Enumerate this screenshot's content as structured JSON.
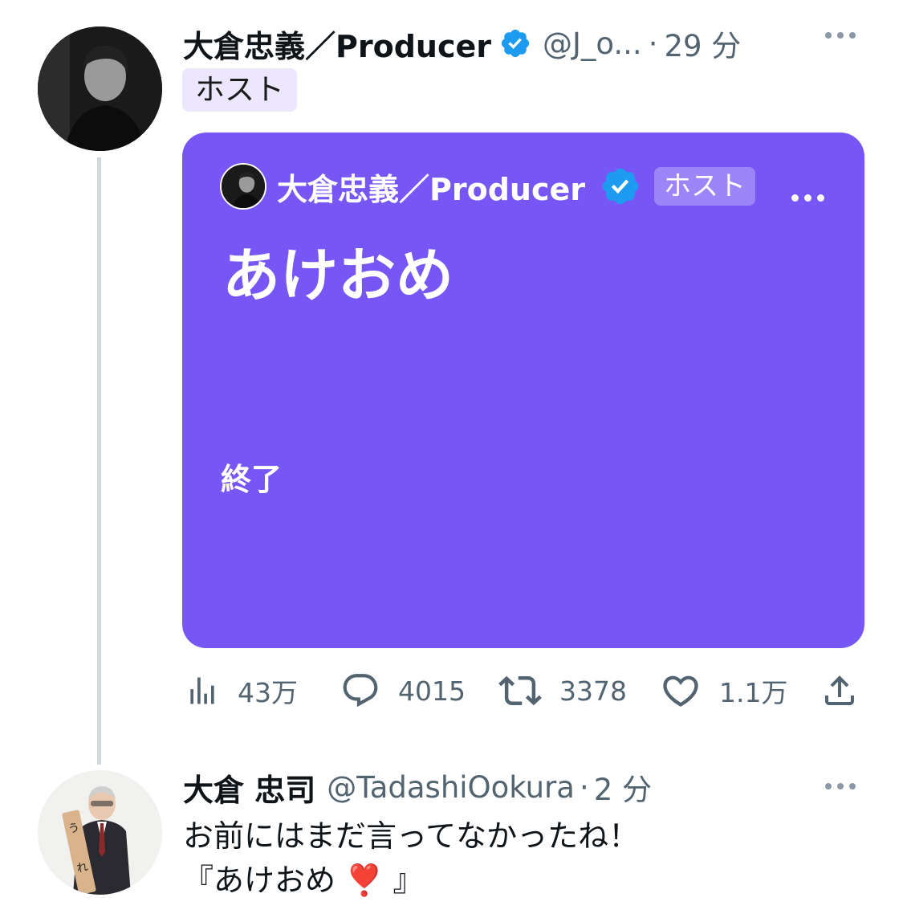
{
  "thread": {
    "tweet1": {
      "name": "大倉忠義／Producer",
      "handle": "@J_o...",
      "dot": "·",
      "time": "29 分",
      "badge": "ホスト",
      "space_card": {
        "host_name": "大倉忠義／Producer",
        "badge": "ホスト",
        "title": "あけおめ",
        "status": "終了",
        "color": "#7656f5"
      },
      "stats": {
        "views": "43万",
        "replies": "4015",
        "retweets": "3378",
        "likes": "1.1万"
      }
    },
    "tweet2": {
      "name": "大倉 忠司",
      "handle": "@TadashiOokura",
      "dot": "·",
      "time": "2 分",
      "lines": [
        "お前にはまだ言ってなかったね！",
        "『あけおめ ❣️ 』"
      ]
    }
  },
  "colors": {
    "verified": "#1d9bf0",
    "secondary_text": "#536471",
    "thread_line": "#cfd9de"
  }
}
